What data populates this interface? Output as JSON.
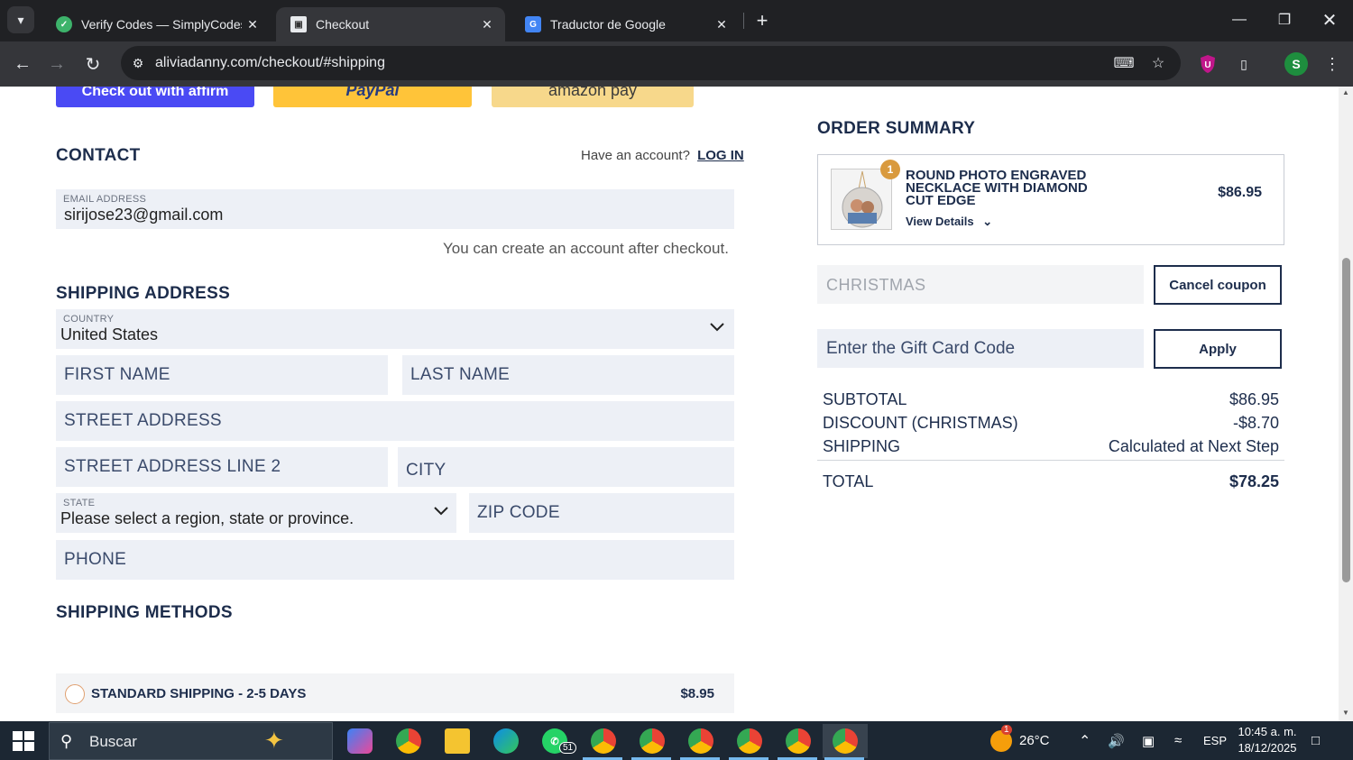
{
  "browser": {
    "tabs": [
      {
        "title": "Verify Codes — SimplyCodes",
        "favicon_color": "#3db36b"
      },
      {
        "title": "Checkout",
        "favicon_color": "#e8eaed"
      },
      {
        "title": "Traductor de Google",
        "favicon_color": "#4285f4"
      }
    ],
    "url": "aliviadanny.com/checkout/#shipping",
    "profile_initial": "S"
  },
  "payment_buttons": {
    "affirm": "Check out with affirm",
    "paypal": "PayPal",
    "amazon": "amazon pay"
  },
  "contact": {
    "title": "CONTACT",
    "have_account": "Have an account?",
    "login": "LOG IN",
    "email_label": "EMAIL ADDRESS",
    "email_value": "sirijose23@gmail.com",
    "create_note": "You can create an account after checkout."
  },
  "shipping": {
    "title": "SHIPPING ADDRESS",
    "country_label": "COUNTRY",
    "country_value": "United States",
    "first_name": "FIRST NAME",
    "last_name": "LAST NAME",
    "street": "STREET ADDRESS",
    "street2": "STREET ADDRESS LINE 2",
    "city": "CITY",
    "state_label": "STATE",
    "state_value": "Please select a region, state or province.",
    "zip": "ZIP CODE",
    "phone": "PHONE"
  },
  "shipping_methods": {
    "title": "SHIPPING METHODS",
    "option_label": "STANDARD SHIPPING - 2-5 DAYS",
    "option_price": "$8.95"
  },
  "order_summary": {
    "title": "ORDER SUMMARY",
    "quantity": "1",
    "product_name": "ROUND PHOTO ENGRAVED NECKLACE WITH DIAMOND CUT EDGE",
    "view_details": "View Details",
    "product_price": "$86.95",
    "coupon_value": "CHRISTMAS",
    "cancel_coupon": "Cancel coupon",
    "gift_placeholder": "Enter the Gift Card Code",
    "apply": "Apply",
    "subtotal_label": "SUBTOTAL",
    "subtotal_value": "$86.95",
    "discount_label": "DISCOUNT (CHRISTMAS)",
    "discount_value": "-$8.70",
    "shipping_label": "SHIPPING",
    "shipping_value": "Calculated at Next Step",
    "total_label": "TOTAL",
    "total_value": "$78.25"
  },
  "taskbar": {
    "search": "Buscar",
    "weather": "26°C",
    "weather_badge": "1",
    "language": "ESP",
    "time": "10:45 a. m.",
    "date": "18/12/2025",
    "whatsapp_badge": "51"
  }
}
